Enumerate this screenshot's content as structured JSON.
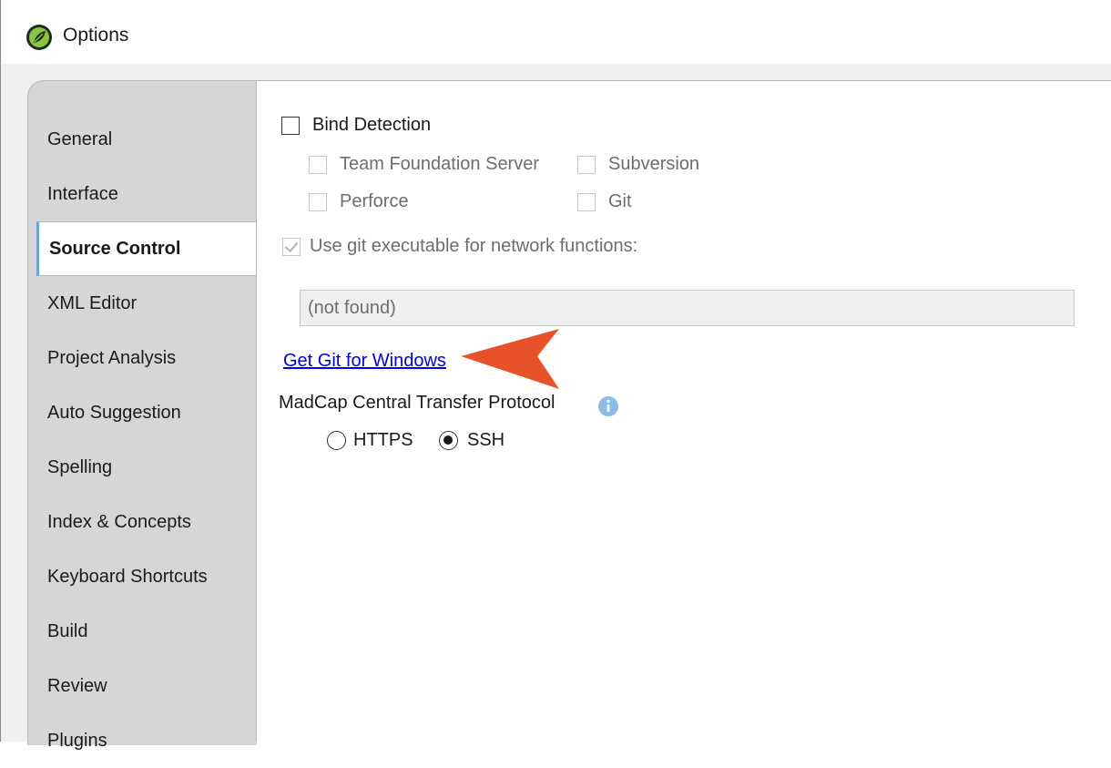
{
  "window": {
    "title": "Options"
  },
  "sidebar": {
    "items": [
      {
        "label": "General",
        "selected": false
      },
      {
        "label": "Interface",
        "selected": false
      },
      {
        "label": "Source Control",
        "selected": true
      },
      {
        "label": "XML Editor",
        "selected": false
      },
      {
        "label": "Project Analysis",
        "selected": false
      },
      {
        "label": "Auto Suggestion",
        "selected": false
      },
      {
        "label": "Spelling",
        "selected": false
      },
      {
        "label": "Index & Concepts",
        "selected": false
      },
      {
        "label": "Keyboard Shortcuts",
        "selected": false
      },
      {
        "label": "Build",
        "selected": false
      },
      {
        "label": "Review",
        "selected": false
      },
      {
        "label": "Plugins",
        "selected": false
      }
    ]
  },
  "source_control": {
    "bind_detection": {
      "label": "Bind Detection",
      "checked": false
    },
    "providers": {
      "tfs": {
        "label": "Team Foundation Server",
        "checked": false,
        "enabled": false
      },
      "subversion": {
        "label": "Subversion",
        "checked": false,
        "enabled": false
      },
      "perforce": {
        "label": "Perforce",
        "checked": false,
        "enabled": false
      },
      "git": {
        "label": "Git",
        "checked": false,
        "enabled": false
      }
    },
    "use_git_exe": {
      "label": "Use git executable for network functions:",
      "checked": true,
      "enabled": false
    },
    "git_path": {
      "value": "(not found)"
    },
    "get_git_link": "Get Git for Windows",
    "protocol": {
      "label": "MadCap Central Transfer Protocol",
      "options": [
        {
          "label": "HTTPS",
          "selected": false
        },
        {
          "label": "SSH",
          "selected": true
        }
      ]
    }
  },
  "icons": {
    "app": "madcap-flare-leaf-icon",
    "info": "info-icon",
    "callout": "callout-arrow"
  },
  "colors": {
    "accent_selected_border": "#6aa6d6",
    "link": "#0000ee",
    "callout_arrow": "#e8522a",
    "info_icon": "#8bbbe8",
    "app_icon_outer": "#1f2a1f",
    "app_icon_leaf": "#8cc63f"
  }
}
